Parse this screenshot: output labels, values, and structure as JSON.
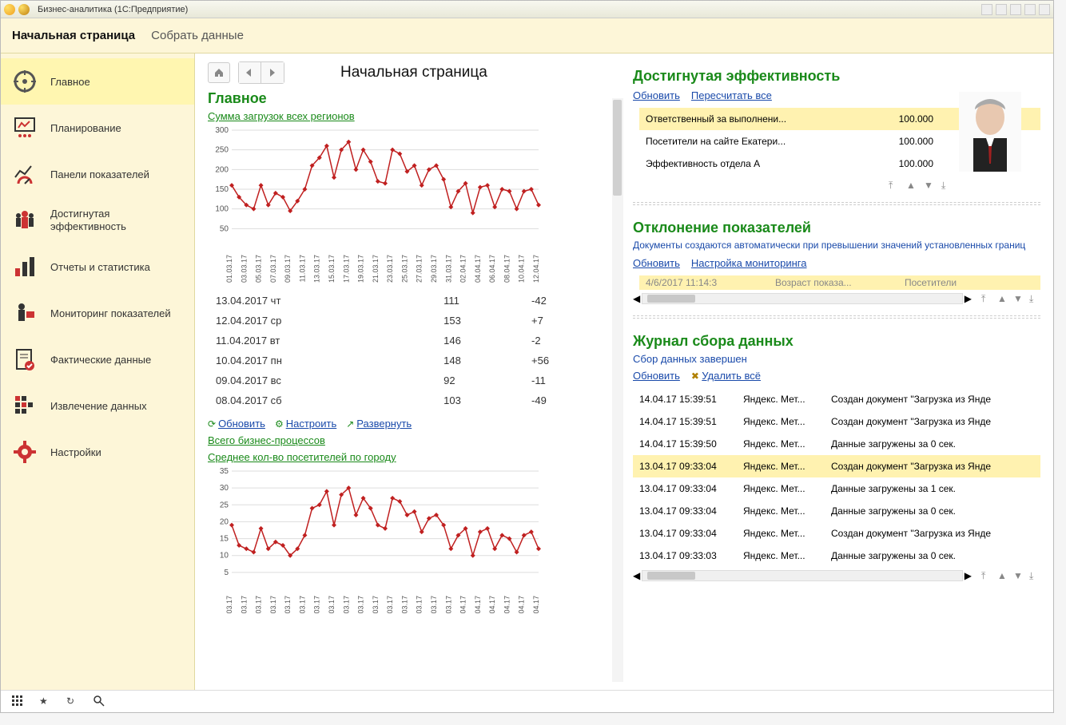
{
  "window_title": "Бизнес-аналитика  (1С:Предприятие)",
  "tabs": {
    "active": "Начальная страница",
    "other": "Собрать данные"
  },
  "sidebar": {
    "items": [
      {
        "label": "Главное"
      },
      {
        "label": "Планирование"
      },
      {
        "label": "Панели показателей"
      },
      {
        "label": "Достигнутая\nэффективность"
      },
      {
        "label": "Отчеты и статистика"
      },
      {
        "label": "Мониторинг показателей"
      },
      {
        "label": "Фактические данные"
      },
      {
        "label": "Извлечение данных"
      },
      {
        "label": "Настройки"
      }
    ]
  },
  "page_title": "Начальная страница",
  "left": {
    "section": "Главное",
    "chart1_title": "Сумма загрузок всех регионов",
    "table": [
      {
        "date": "13.04.2017 чт",
        "v1": "111",
        "v2": "-42"
      },
      {
        "date": "12.04.2017 ср",
        "v1": "153",
        "v2": "+7"
      },
      {
        "date": "11.04.2017 вт",
        "v1": "146",
        "v2": "-2"
      },
      {
        "date": "10.04.2017 пн",
        "v1": "148",
        "v2": "+56"
      },
      {
        "date": "09.04.2017 вс",
        "v1": "92",
        "v2": "-11"
      },
      {
        "date": "08.04.2017 сб",
        "v1": "103",
        "v2": "-49"
      }
    ],
    "actions": {
      "refresh": "Обновить",
      "setup": "Настроить",
      "expand": "Развернуть"
    },
    "link2": "Всего бизнес-процессов",
    "chart2_title": "Среднее кол-во посетителей по городу"
  },
  "right": {
    "eff": {
      "title": "Достигнутая эффективность",
      "links": {
        "refresh": "Обновить",
        "recalc": "Пересчитать все"
      },
      "rows": [
        {
          "name": "Ответственный за выполнени...",
          "value": "100.000",
          "hl": true
        },
        {
          "name": "Посетители на сайте Екатери...",
          "value": "100.000",
          "hl": false
        },
        {
          "name": "Эффективность отдела А",
          "value": "100.000",
          "hl": false
        }
      ]
    },
    "dev": {
      "title": "Отклонение показателей",
      "hint": "Документы создаются автоматически при превышении значений установленных границ",
      "links": {
        "refresh": "Обновить",
        "setup": "Настройка мониторинга"
      },
      "trunc": {
        "c1": "4/6/2017 11:14:3",
        "c2": "Возраст показа...",
        "c3": "Посетители"
      }
    },
    "log": {
      "title": "Журнал сбора данных",
      "sub": "Сбор данных завершен",
      "links": {
        "refresh": "Обновить",
        "del": "Удалить всё"
      },
      "rows": [
        {
          "t": "14.04.17 15:39:51",
          "s": "Яндекс. Мет...",
          "m": "Создан документ \"Загрузка из Янде",
          "hl": false
        },
        {
          "t": "14.04.17 15:39:51",
          "s": "Яндекс. Мет...",
          "m": "Создан документ \"Загрузка из Янде",
          "hl": false
        },
        {
          "t": "14.04.17 15:39:50",
          "s": "Яндекс. Мет...",
          "m": "Данные загружены за 0 сек.",
          "hl": false
        },
        {
          "t": "13.04.17 09:33:04",
          "s": "Яндекс. Мет...",
          "m": "Создан документ \"Загрузка из Янде",
          "hl": true
        },
        {
          "t": "13.04.17 09:33:04",
          "s": "Яндекс. Мет...",
          "m": "Данные загружены за 1 сек.",
          "hl": false
        },
        {
          "t": "13.04.17 09:33:04",
          "s": "Яндекс. Мет...",
          "m": "Данные загружены за 0 сек.",
          "hl": false
        },
        {
          "t": "13.04.17 09:33:04",
          "s": "Яндекс. Мет...",
          "m": "Создан документ \"Загрузка из Янде",
          "hl": false
        },
        {
          "t": "13.04.17 09:33:03",
          "s": "Яндекс. Мет...",
          "m": "Данные загружены за 0 сек.",
          "hl": false
        }
      ]
    }
  },
  "chart_data": [
    {
      "type": "line",
      "title": "Сумма загрузок всех регионов",
      "ylim": [
        0,
        300
      ],
      "yticks": [
        50,
        100,
        150,
        200,
        250,
        300
      ],
      "x": [
        "01.03.17",
        "03.03.17",
        "05.03.17",
        "07.03.17",
        "09.03.17",
        "11.03.17",
        "13.03.17",
        "15.03.17",
        "17.03.17",
        "19.03.17",
        "21.03.17",
        "23.03.17",
        "25.03.17",
        "27.03.17",
        "29.03.17",
        "31.03.17",
        "02.04.17",
        "04.04.17",
        "06.04.17",
        "08.04.17",
        "10.04.17",
        "12.04.17"
      ],
      "values": [
        160,
        130,
        110,
        100,
        160,
        110,
        140,
        130,
        95,
        120,
        150,
        210,
        230,
        260,
        180,
        250,
        270,
        200,
        250,
        220,
        170,
        165,
        250,
        240,
        195,
        210,
        160,
        200,
        210,
        175,
        105,
        145,
        165,
        90,
        155,
        160,
        105,
        150,
        145,
        100,
        145,
        150,
        110
      ]
    },
    {
      "type": "line",
      "title": "Среднее кол-во посетителей по городу",
      "ylim": [
        0,
        35
      ],
      "yticks": [
        5,
        10,
        15,
        20,
        25,
        30,
        35
      ],
      "x": [
        "03.17",
        "03.17",
        "03.17",
        "03.17",
        "03.17",
        "03.17",
        "03.17",
        "03.17",
        "03.17",
        "03.17",
        "03.17",
        "03.17",
        "03.17",
        "03.17",
        "03.17",
        "03.17",
        "04.17",
        "04.17",
        "04.17",
        "04.17",
        "04.17",
        "04.17"
      ],
      "values": [
        19,
        13,
        12,
        11,
        18,
        12,
        14,
        13,
        10,
        12,
        16,
        24,
        25,
        29,
        19,
        28,
        30,
        22,
        27,
        24,
        19,
        18,
        27,
        26,
        22,
        23,
        17,
        21,
        22,
        19,
        12,
        16,
        18,
        10,
        17,
        18,
        12,
        16,
        15,
        11,
        16,
        17,
        12
      ]
    }
  ]
}
